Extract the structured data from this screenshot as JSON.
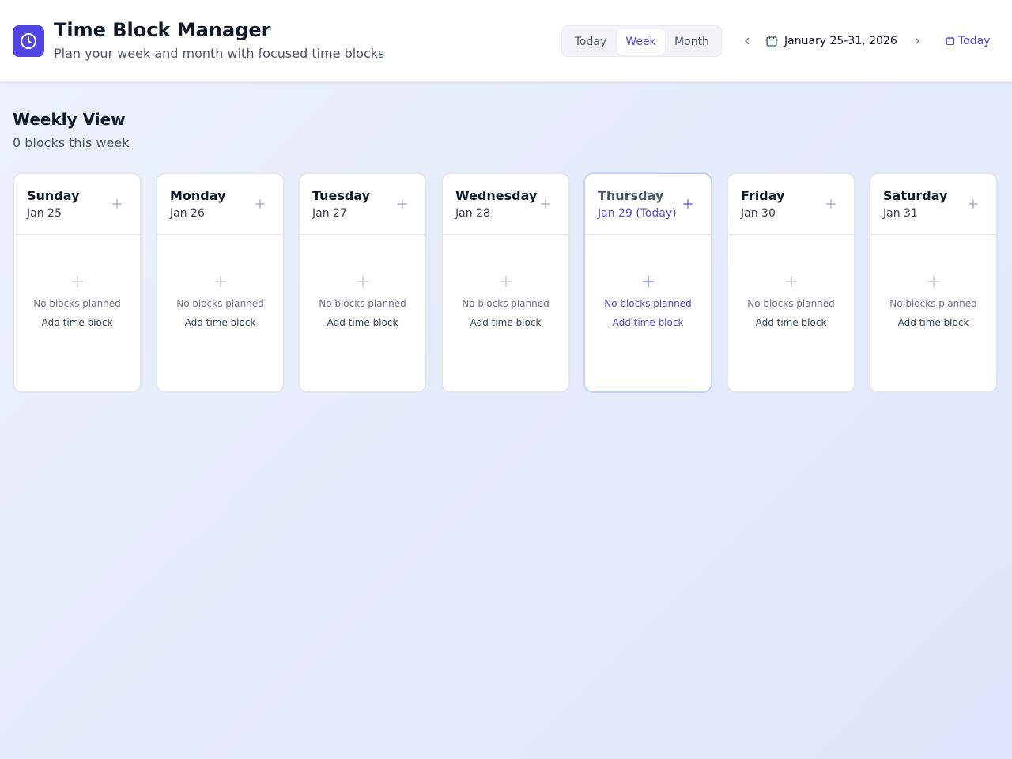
{
  "header": {
    "title": "Time Block Manager",
    "subtitle": "Plan your week and month with focused time blocks",
    "logo_icon": "clock-icon",
    "accent_color": "#4f46e5"
  },
  "view_switch": {
    "options": [
      "Today",
      "Week",
      "Month"
    ],
    "selected": "Week"
  },
  "date_nav": {
    "range_label": "January 25-31, 2026",
    "today_label": "Today"
  },
  "weekly": {
    "title": "Weekly View",
    "summary": "0 blocks this week",
    "days": [
      {
        "name": "Sunday",
        "date": "Jan 25",
        "is_today": false,
        "empty_text": "No blocks planned",
        "add_label": "Add time block"
      },
      {
        "name": "Monday",
        "date": "Jan 26",
        "is_today": false,
        "empty_text": "No blocks planned",
        "add_label": "Add time block"
      },
      {
        "name": "Tuesday",
        "date": "Jan 27",
        "is_today": false,
        "empty_text": "No blocks planned",
        "add_label": "Add time block"
      },
      {
        "name": "Wednesday",
        "date": "Jan 28",
        "is_today": false,
        "empty_text": "No blocks planned",
        "add_label": "Add time block"
      },
      {
        "name": "Thursday",
        "date": "Jan 29 (Today)",
        "is_today": true,
        "empty_text": "No blocks planned",
        "add_label": "Add time block"
      },
      {
        "name": "Friday",
        "date": "Jan 30",
        "is_today": false,
        "empty_text": "No blocks planned",
        "add_label": "Add time block"
      },
      {
        "name": "Saturday",
        "date": "Jan 31",
        "is_today": false,
        "empty_text": "No blocks planned",
        "add_label": "Add time block"
      }
    ]
  }
}
